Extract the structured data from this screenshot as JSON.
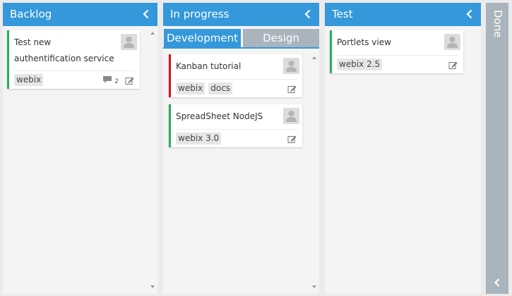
{
  "columns": [
    {
      "title": "Backlog",
      "cards": [
        {
          "text": "Test new authentification service",
          "tags": [
            "webix"
          ],
          "comments": "2"
        }
      ]
    },
    {
      "title": "In progress",
      "tabs": [
        "Development",
        "Design"
      ],
      "cards": [
        {
          "text": "Kanban tutorial",
          "tags": [
            "webix",
            "docs"
          ]
        },
        {
          "text": "SpreadSheet NodeJS",
          "tags": [
            "webix 3.0"
          ]
        }
      ]
    },
    {
      "title": "Test",
      "cards": [
        {
          "text": "Portlets view",
          "tags": [
            "webix 2.5"
          ]
        }
      ]
    }
  ],
  "done": {
    "title": "Done"
  },
  "colors": {
    "header": "#3498db",
    "collapsed": "#a9b4bd",
    "green": "#27ae60",
    "red": "#e3111d"
  }
}
